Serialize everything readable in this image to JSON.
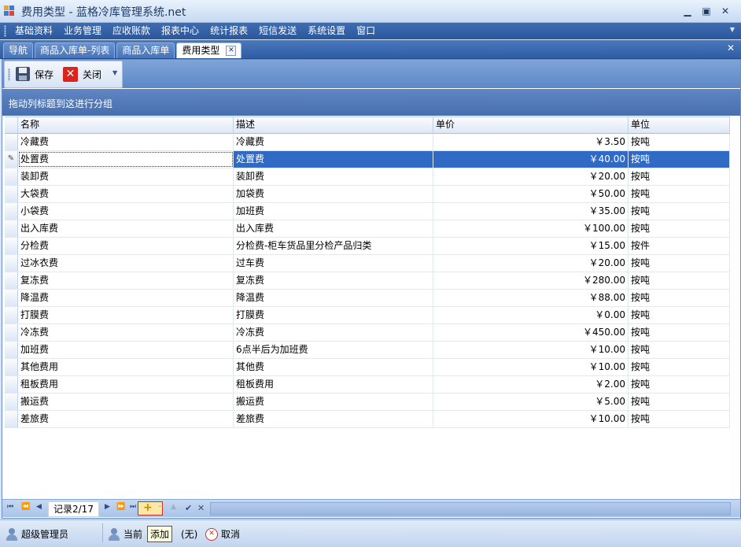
{
  "window": {
    "title": "费用类型 - 蓝格冷库管理系统.net",
    "minimize": "▁",
    "restore": "▣",
    "close": "✕"
  },
  "menu": [
    "基础资料",
    "业务管理",
    "应收账款",
    "报表中心",
    "统计报表",
    "短信发送",
    "系统设置",
    "窗口"
  ],
  "tabs": [
    {
      "label": "导航"
    },
    {
      "label": "商品入库单-列表"
    },
    {
      "label": "商品入库单"
    },
    {
      "label": "费用类型"
    }
  ],
  "toolbar": {
    "save_label": "保存",
    "close_label": "关闭"
  },
  "grid": {
    "group_panel_text": "拖动列标题到这进行分组",
    "columns": [
      "名称",
      "描述",
      "单价",
      "单位"
    ],
    "rows": [
      {
        "name": "冷藏费",
        "desc": "冷藏费",
        "price": "￥3.50",
        "unit": "按吨"
      },
      {
        "name": "处置费",
        "desc": "处置费",
        "price": "￥40.00",
        "unit": "按吨"
      },
      {
        "name": "装卸费",
        "desc": "装卸费",
        "price": "￥20.00",
        "unit": "按吨"
      },
      {
        "name": "大袋费",
        "desc": "加袋费",
        "price": "￥50.00",
        "unit": "按吨"
      },
      {
        "name": "小袋费",
        "desc": "加班费",
        "price": "￥35.00",
        "unit": "按吨"
      },
      {
        "name": "出入库费",
        "desc": "出入库费",
        "price": "￥100.00",
        "unit": "按吨"
      },
      {
        "name": "分检费",
        "desc": "分检费-柜车货品里分检产品归类",
        "price": "￥15.00",
        "unit": "按件"
      },
      {
        "name": "过冰衣费",
        "desc": "过车费",
        "price": "￥20.00",
        "unit": "按吨"
      },
      {
        "name": "复冻费",
        "desc": "复冻费",
        "price": "￥280.00",
        "unit": "按吨"
      },
      {
        "name": "降温费",
        "desc": "降温费",
        "price": "￥88.00",
        "unit": "按吨"
      },
      {
        "name": "打膜费",
        "desc": "打膜费",
        "price": "￥0.00",
        "unit": "按吨"
      },
      {
        "name": "冷冻费",
        "desc": "冷冻费",
        "price": "￥450.00",
        "unit": "按吨"
      },
      {
        "name": "加班费",
        "desc": "6点半后为加班费",
        "price": "￥10.00",
        "unit": "按吨"
      },
      {
        "name": "其他费用",
        "desc": "其他费",
        "price": "￥10.00",
        "unit": "按吨"
      },
      {
        "name": "租板费用",
        "desc": "租板费用",
        "price": "￥2.00",
        "unit": "按吨"
      },
      {
        "name": "搬运费",
        "desc": "搬运费",
        "price": "￥5.00",
        "unit": "按吨"
      },
      {
        "name": "差旅费",
        "desc": "差旅费",
        "price": "￥10.00",
        "unit": "按吨"
      }
    ],
    "selected_row_index": 1
  },
  "navigator": {
    "record_text": "记录2/17",
    "tooltip": "添加"
  },
  "status": {
    "user": "超级管理员",
    "current_prefix": "当前",
    "none_text": "(无)",
    "cancel_label": "取消"
  }
}
